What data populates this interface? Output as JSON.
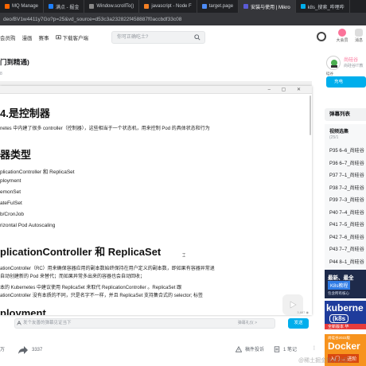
{
  "browser": {
    "tabs": [
      {
        "label": "MQ Manage",
        "color": "#ff6600"
      },
      {
        "label": "满点 - 掘金",
        "color": "#1e80ff"
      },
      {
        "label": "Window.scrollTo()",
        "color": "#888888"
      },
      {
        "label": "javascript - Node F",
        "color": "#f48024"
      },
      {
        "label": "target.page",
        "color": "#4c8bf5"
      },
      {
        "label": "安装与使用 | Mikro",
        "color": "#5b5bd6"
      },
      {
        "label": "k8s_搜索_哔哩哔",
        "color": "#00aeec"
      }
    ],
    "url": "deo/BV1w4411y7Go?p=25&vd_source=d53c3a232822f458887f0accbdf33c08"
  },
  "nav": {
    "links": [
      "会员购",
      "漫画",
      "赛事"
    ],
    "download_client": "下载客户端",
    "search_placeholder": "你可正确吃土?",
    "member_label": "大会员",
    "message_label": "消息"
  },
  "video": {
    "title": "门到精通)",
    "subtitle": "8"
  },
  "doc": {
    "heading1": "4.是控制器",
    "para1": "netes 中内建了很多 controller（控制器），这些相当于一个状态机，用来控制 Pod 的具体状态和行为",
    "heading2": "器类型",
    "types": [
      "plicationController 和 ReplicaSet",
      "ployment",
      "emonSet",
      "ateFulSet",
      "b/CronJob",
      "rizontal Pod Autoscaling"
    ],
    "heading3": "plicationController 和 ReplicaSet",
    "para3a": "ationController（RC）用来确保容器应用的副本数始终保持在用户定义的副本数，即如果有容器异常退",
    "para3b": "自动创建新的 Pod 来替代；而如果异常多出来的容器也会自动回收；",
    "para3c": "本的 Kubernetes 中建议使用 ReplicaSet 来取代 ReplicationController 。ReplicaSet 跟",
    "para3d": "ationController 没有本质的不同，只是名字不一样，并且 ReplicaSet 支持集合式的 selector;    标签",
    "heading4": "ployment",
    "page_number": "3,687 ◉"
  },
  "danmaku": {
    "placeholder": "发个友善的弹幕见证当下",
    "etiquette": "弹幕礼仪 >",
    "send": "发送"
  },
  "stats": {
    "likes": "万",
    "shares": "3337",
    "report": "稿件投诉",
    "notes": "1 笔记"
  },
  "up": {
    "name": "尚硅谷",
    "desc": "尚硅谷IT教",
    "label": "硅谷",
    "charge": "充电"
  },
  "danmaku_list": {
    "header": "弹幕列表"
  },
  "playlist": {
    "title": "视频选集",
    "sub": "(25/1",
    "items": [
      "P35  6–6_尚硅谷",
      "P36  6–7_尚硅谷",
      "P37  7–1_尚硅谷",
      "P38  7–2_尚硅谷",
      "P39  7–3_尚硅谷",
      "P40  7–4_尚硅谷",
      "P41  7–5_尚硅谷",
      "P42  7–6_尚硅谷",
      "P43  7–7_尚硅谷",
      "P44  8–1_尚硅谷"
    ]
  },
  "banners": {
    "b1_line1": "最新、最全",
    "b1_line2": "K8s教程",
    "b1_line3": "包含所有核心",
    "b2_line1": "kuberne",
    "b2_line2": "(k8s",
    "b2_line3": "全新版本 毕",
    "b3_line1": "尚硅谷2022版",
    "b3_line2": "Docker",
    "b3_line3": "入门 → 进阶"
  },
  "watermark": "@稀土掘金技术社区"
}
